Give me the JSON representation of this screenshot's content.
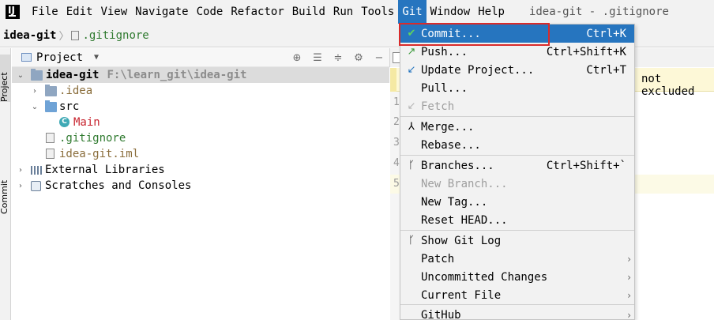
{
  "menubar": {
    "logo": "IJ",
    "items": [
      {
        "label": "File"
      },
      {
        "label": "Edit"
      },
      {
        "label": "View"
      },
      {
        "label": "Navigate"
      },
      {
        "label": "Code"
      },
      {
        "label": "Refactor"
      },
      {
        "label": "Build"
      },
      {
        "label": "Run"
      },
      {
        "label": "Tools"
      },
      {
        "label": "Git"
      },
      {
        "label": "Window"
      },
      {
        "label": "Help"
      }
    ],
    "window_title": "idea-git - .gitignore"
  },
  "breadcrumb": {
    "project": "idea-git",
    "file": ".gitignore"
  },
  "tool_stripe": {
    "project_tab": "Project",
    "commit_tab": "Commit"
  },
  "project_panel": {
    "title": "Project",
    "tree": {
      "root_name": "idea-git",
      "root_path": "F:\\learn_git\\idea-git",
      "idea_folder": ".idea",
      "src_folder": "src",
      "main_class": "Main",
      "gitignore_file": ".gitignore",
      "iml_file": "idea-git.iml",
      "external_libraries": "External Libraries",
      "scratches": "Scratches and Consoles"
    }
  },
  "editor": {
    "banner_text": "not excluded",
    "line_numbers": [
      "1",
      "2",
      "3",
      "4",
      "5"
    ]
  },
  "git_menu": {
    "items": [
      {
        "label": "Commit...",
        "shortcut": "Ctrl+K",
        "icon": "check-icon"
      },
      {
        "label": "Push...",
        "shortcut": "Ctrl+Shift+K",
        "icon": "push-arrow-icon"
      },
      {
        "label": "Update Project...",
        "shortcut": "Ctrl+T",
        "icon": "update-arrow-icon"
      },
      {
        "label": "Pull...",
        "shortcut": ""
      },
      {
        "label": "Fetch",
        "shortcut": "",
        "icon": "fetch-icon"
      },
      {
        "label": "Merge...",
        "icon": "merge-icon"
      },
      {
        "label": "Rebase..."
      },
      {
        "label": "Branches...",
        "shortcut": "Ctrl+Shift+`",
        "icon": "branch-icon"
      },
      {
        "label": "New Branch..."
      },
      {
        "label": "New Tag..."
      },
      {
        "label": "Reset HEAD..."
      },
      {
        "label": "Show Git Log",
        "icon": "git-log-icon"
      },
      {
        "label": "Patch"
      },
      {
        "label": "Uncommitted Changes"
      },
      {
        "label": "Current File"
      },
      {
        "label": "GitHub"
      }
    ]
  },
  "colors": {
    "accent": "#2675bf",
    "highlight_box": "#d92b2b"
  }
}
